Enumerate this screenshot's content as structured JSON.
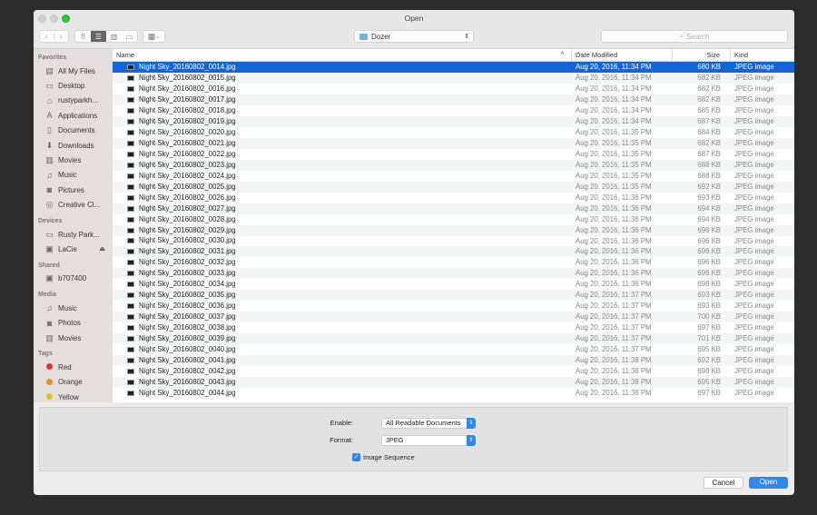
{
  "window": {
    "title": "Open"
  },
  "toolbar": {
    "back": "‹",
    "forward": "›",
    "location": "Dozer",
    "search_placeholder": "Search"
  },
  "sidebar": {
    "sections": [
      {
        "header": "Favorites",
        "items": [
          {
            "label": "All My Files",
            "icon": "all-files-icon"
          },
          {
            "label": "Desktop",
            "icon": "desktop-icon"
          },
          {
            "label": "rustyparkh...",
            "icon": "home-icon"
          },
          {
            "label": "Applications",
            "icon": "applications-icon"
          },
          {
            "label": "Documents",
            "icon": "documents-icon"
          },
          {
            "label": "Downloads",
            "icon": "downloads-icon"
          },
          {
            "label": "Movies",
            "icon": "movies-icon"
          },
          {
            "label": "Music",
            "icon": "music-icon"
          },
          {
            "label": "Pictures",
            "icon": "pictures-icon"
          },
          {
            "label": "Creative Cl...",
            "icon": "creative-cloud-icon"
          }
        ]
      },
      {
        "header": "Devices",
        "items": [
          {
            "label": "Rusty Park...",
            "icon": "computer-icon"
          },
          {
            "label": "LaCie",
            "icon": "drive-icon",
            "eject": true
          }
        ]
      },
      {
        "header": "Shared",
        "items": [
          {
            "label": "b707400",
            "icon": "network-computer-icon"
          }
        ]
      },
      {
        "header": "Media",
        "items": [
          {
            "label": "Music",
            "icon": "music-icon"
          },
          {
            "label": "Photos",
            "icon": "camera-icon"
          },
          {
            "label": "Movies",
            "icon": "movies-icon"
          }
        ]
      },
      {
        "header": "Tags",
        "items": [
          {
            "label": "Red",
            "color": "#e8302c"
          },
          {
            "label": "Orange",
            "color": "#f08a1c"
          },
          {
            "label": "Yellow",
            "color": "#e8c01c"
          }
        ]
      }
    ]
  },
  "columns": {
    "name": "Name",
    "date": "Date Modified",
    "size": "Size",
    "kind": "Kind"
  },
  "files": [
    [
      "Night Sky_20160802_0014.jpg",
      "Aug 20, 2016, 11:34 PM",
      "680 KB"
    ],
    [
      "Night Sky_20160802_0015.jpg",
      "Aug 20, 2016, 11:34 PM",
      "682 KB"
    ],
    [
      "Night Sky_20160802_0016.jpg",
      "Aug 20, 2016, 11:34 PM",
      "682 KB"
    ],
    [
      "Night Sky_20160802_0017.jpg",
      "Aug 20, 2016, 11:34 PM",
      "682 KB"
    ],
    [
      "Night Sky_20160802_0018.jpg",
      "Aug 20, 2016, 11:34 PM",
      "685 KB"
    ],
    [
      "Night Sky_20160802_0019.jpg",
      "Aug 20, 2016, 11:34 PM",
      "687 KB"
    ],
    [
      "Night Sky_20160802_0020.jpg",
      "Aug 20, 2016, 11:35 PM",
      "684 KB"
    ],
    [
      "Night Sky_20160802_0021.jpg",
      "Aug 20, 2016, 11:35 PM",
      "682 KB"
    ],
    [
      "Night Sky_20160802_0022.jpg",
      "Aug 20, 2016, 11:35 PM",
      "687 KB"
    ],
    [
      "Night Sky_20160802_0023.jpg",
      "Aug 20, 2016, 11:35 PM",
      "688 KB"
    ],
    [
      "Night Sky_20160802_0024.jpg",
      "Aug 20, 2016, 11:35 PM",
      "688 KB"
    ],
    [
      "Night Sky_20160802_0025.jpg",
      "Aug 20, 2016, 11:35 PM",
      "692 KB"
    ],
    [
      "Night Sky_20160802_0026.jpg",
      "Aug 20, 2016, 11:36 PM",
      "693 KB"
    ],
    [
      "Night Sky_20160802_0027.jpg",
      "Aug 20, 2016, 11:36 PM",
      "694 KB"
    ],
    [
      "Night Sky_20160802_0028.jpg",
      "Aug 20, 2016, 11:36 PM",
      "694 KB"
    ],
    [
      "Night Sky_20160802_0029.jpg",
      "Aug 20, 2016, 11:36 PM",
      "696 KB"
    ],
    [
      "Night Sky_20160802_0030.jpg",
      "Aug 20, 2016, 11:36 PM",
      "696 KB"
    ],
    [
      "Night Sky_20160802_0031.jpg",
      "Aug 20, 2016, 11:36 PM",
      "696 KB"
    ],
    [
      "Night Sky_20160802_0032.jpg",
      "Aug 20, 2016, 11:36 PM",
      "696 KB"
    ],
    [
      "Night Sky_20160802_0033.jpg",
      "Aug 20, 2016, 11:36 PM",
      "696 KB"
    ],
    [
      "Night Sky_20160802_0034.jpg",
      "Aug 20, 2016, 11:36 PM",
      "698 KB"
    ],
    [
      "Night Sky_20160802_0035.jpg",
      "Aug 20, 2016, 11:37 PM",
      "693 KB"
    ],
    [
      "Night Sky_20160802_0036.jpg",
      "Aug 20, 2016, 11:37 PM",
      "693 KB"
    ],
    [
      "Night Sky_20160802_0037.jpg",
      "Aug 20, 2016, 11:37 PM",
      "700 KB"
    ],
    [
      "Night Sky_20160802_0038.jpg",
      "Aug 20, 2016, 11:37 PM",
      "697 KB"
    ],
    [
      "Night Sky_20160802_0039.jpg",
      "Aug 20, 2016, 11:37 PM",
      "701 KB"
    ],
    [
      "Night Sky_20160802_0040.jpg",
      "Aug 20, 2016, 11:37 PM",
      "695 KB"
    ],
    [
      "Night Sky_20160802_0041.jpg",
      "Aug 20, 2016, 11:38 PM",
      "692 KB"
    ],
    [
      "Night Sky_20160802_0042.jpg",
      "Aug 20, 2016, 11:38 PM",
      "698 KB"
    ],
    [
      "Night Sky_20160802_0043.jpg",
      "Aug 20, 2016, 11:38 PM",
      "695 KB"
    ],
    [
      "Night Sky_20160802_0044.jpg",
      "Aug 20, 2016, 11:38 PM",
      "697 KB"
    ]
  ],
  "file_kind": "JPEG image",
  "selected_index": 0,
  "options": {
    "enable_label": "Enable:",
    "enable_value": "All Readable Documents",
    "format_label": "Format:",
    "format_value": "JPEG",
    "sequence_label": "Image Sequence",
    "sequence_checked": true
  },
  "buttons": {
    "cancel": "Cancel",
    "open": "Open"
  },
  "colors": {
    "accent": "#1565d6",
    "button_blue": "#2f88f0"
  }
}
